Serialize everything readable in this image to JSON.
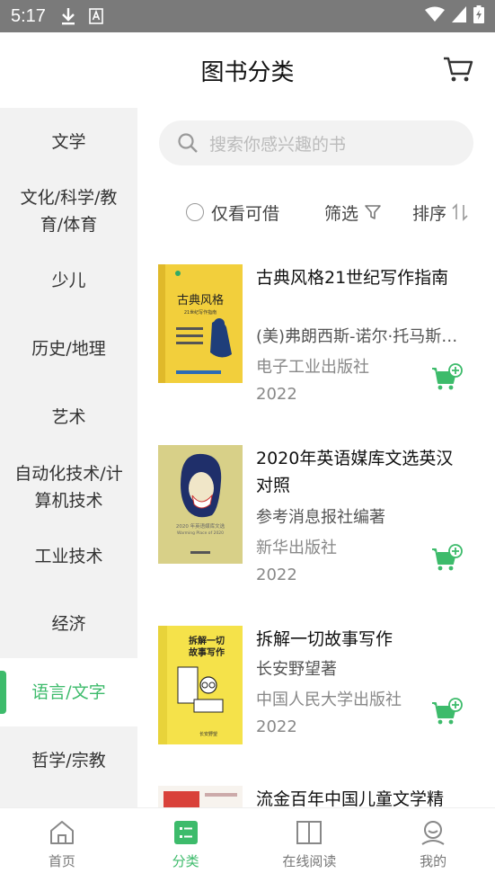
{
  "status": {
    "time": "5:17"
  },
  "header": {
    "title": "图书分类"
  },
  "categories": [
    {
      "label": "文学"
    },
    {
      "label": "文化/科学/教育/体育"
    },
    {
      "label": "少儿"
    },
    {
      "label": "历史/地理"
    },
    {
      "label": "艺术"
    },
    {
      "label": "自动化技术/计算机技术"
    },
    {
      "label": "工业技术"
    },
    {
      "label": "经济"
    },
    {
      "label": "语言/文字",
      "active": true
    },
    {
      "label": "哲学/宗教"
    }
  ],
  "search": {
    "placeholder": "搜索你感兴趣的书"
  },
  "filters": {
    "available_only": "仅看可借",
    "filter": "筛选",
    "sort": "排序"
  },
  "books": [
    {
      "title": "古典风格21世纪写作指南",
      "author": "(美)弗朗西斯-诺尔·托马斯…",
      "publisher": "电子工业出版社",
      "year": "2022"
    },
    {
      "title": "2020年英语媒库文选英汉对照",
      "author": "参考消息报社编著",
      "publisher": "新华出版社",
      "year": "2022"
    },
    {
      "title": "拆解一切故事写作",
      "author": "长安野望著",
      "publisher": "中国人民大学出版社",
      "year": "2022"
    },
    {
      "title": "流金百年中国儿童文学精",
      "author": "",
      "publisher": "",
      "year": ""
    }
  ],
  "covers": [
    {
      "title": "古典风格",
      "subtitle": "21世纪写作指南",
      "color": "#f2cf3c"
    },
    {
      "title": "2020 年英语媒库文选",
      "subtitle": "Warming Place of 2020",
      "color": "#d8d088"
    },
    {
      "title": "拆解一切故事写作",
      "subtitle": "长安野望",
      "color": "#f5e24a"
    }
  ],
  "tabs": [
    {
      "label": "首页",
      "icon": "home-icon"
    },
    {
      "label": "分类",
      "icon": "category-icon",
      "active": true
    },
    {
      "label": "在线阅读",
      "icon": "book-open-icon"
    },
    {
      "label": "我的",
      "icon": "user-icon"
    }
  ],
  "colors": {
    "accent": "#3dbb6b",
    "statusbar": "#7a7a7a",
    "sidebar_bg": "#f2f2f2"
  }
}
